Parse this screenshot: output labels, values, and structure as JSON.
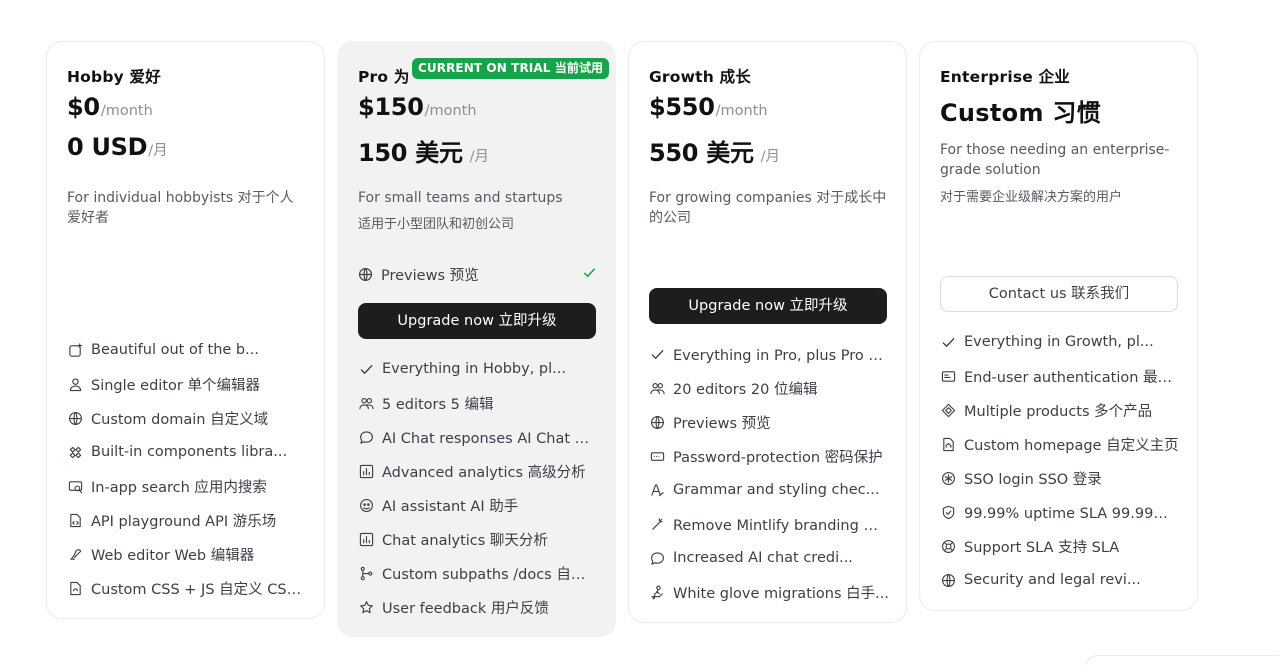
{
  "plans": {
    "hobby": {
      "name": "Hobby  爱好",
      "price": "$0",
      "price_unit": "/month",
      "price_cny": "0 USD",
      "price_cny_unit": "/月",
      "description": "For individual hobbyists  对于个人爱好者",
      "features": [
        {
          "icon": "sparkle-icon",
          "text": "Beautiful out of the b..."
        },
        {
          "icon": "user-icon",
          "text": "Single editor  单个编辑器"
        },
        {
          "icon": "globe-icon",
          "text": "Custom domain  自定义域"
        },
        {
          "icon": "components-icon",
          "text": "Built-in components libra..."
        },
        {
          "icon": "search-icon",
          "text": "In-app search  应用内搜索"
        },
        {
          "icon": "file-code-icon",
          "text": "API playground  API 游乐场"
        },
        {
          "icon": "pen-icon",
          "text": "Web editor  Web 编辑器"
        },
        {
          "icon": "file-css-icon",
          "text": "Custom CSS + JS  自定义 CSS ..."
        }
      ]
    },
    "pro": {
      "name": "Pro  为",
      "badge": "CURRENT ON TRIAL  当前试用",
      "price": "$150",
      "price_unit": "/month",
      "price_cny": "150 美元",
      "price_cny_unit": "/月",
      "description_en": "For small teams and startups",
      "description_zh": "适用于小型团队和初创公司",
      "preview_label": "Previews  预览",
      "cta": "Upgrade now  立即升级",
      "features": [
        {
          "icon": "check-icon",
          "text": "Everything in Hobby, pl..."
        },
        {
          "icon": "users-icon",
          "text": "5 editors  5 编辑"
        },
        {
          "icon": "chat-icon",
          "text": "AI Chat responses  AI Chat 响应"
        },
        {
          "icon": "chart-icon",
          "text": "Advanced analytics  高级分析"
        },
        {
          "icon": "bot-icon",
          "text": "AI assistant  AI 助手"
        },
        {
          "icon": "chart-icon",
          "text": "Chat analytics  聊天分析"
        },
        {
          "icon": "branch-icon",
          "text": "Custom subpaths /docs  自定..."
        },
        {
          "icon": "star-icon",
          "text": "User feedback  用户反馈"
        }
      ]
    },
    "growth": {
      "name": "Growth  成长",
      "price": "$550",
      "price_unit": "/month",
      "price_cny": "550 美元",
      "price_cny_unit": "/月",
      "description": "For growing companies  对于成长中的公司",
      "cta": "Upgrade now  立即升级",
      "features": [
        {
          "icon": "check-icon",
          "text": "Everything in Pro, plus  Pro 中..."
        },
        {
          "icon": "users-icon",
          "text": "20 editors  20 位编辑"
        },
        {
          "icon": "globe-icon",
          "text": "Previews  预览"
        },
        {
          "icon": "password-icon",
          "text": "Password-protection  密码保护"
        },
        {
          "icon": "grammar-icon",
          "text": "Grammar and styling chec..."
        },
        {
          "icon": "wand-icon",
          "text": "Remove Mintlify branding  删..."
        },
        {
          "icon": "chat-icon",
          "text": "Increased AI chat credi..."
        },
        {
          "icon": "migrate-icon",
          "text": "White glove migrations  白手..."
        }
      ]
    },
    "enterprise": {
      "name": "Enterprise  企业",
      "price_custom": "Custom  习惯",
      "description_en": "For those needing an enterprise-grade solution",
      "description_zh": "对于需要企业级解决方案的用户",
      "cta": "Contact us  联系我们",
      "features": [
        {
          "icon": "check-icon",
          "text": "Everything in Growth, pl..."
        },
        {
          "icon": "id-card-icon",
          "text": "End-user authentication  最终..."
        },
        {
          "icon": "products-icon",
          "text": "Multiple products  多个产品"
        },
        {
          "icon": "file-home-icon",
          "text": "Custom homepage  自定义主页"
        },
        {
          "icon": "sso-icon",
          "text": "SSO login  SSO 登录"
        },
        {
          "icon": "shield-icon",
          "text": "99.99% uptime SLA  99.99% 正..."
        },
        {
          "icon": "lifebuoy-icon",
          "text": "Support SLA  支持 SLA"
        },
        {
          "icon": "globe-icon",
          "text": "Security and legal revi..."
        }
      ]
    }
  },
  "colors": {
    "accent_green": "#16a34a",
    "button_dark": "#1d1d1f",
    "pro_card_bg": "#f2f2f2"
  }
}
